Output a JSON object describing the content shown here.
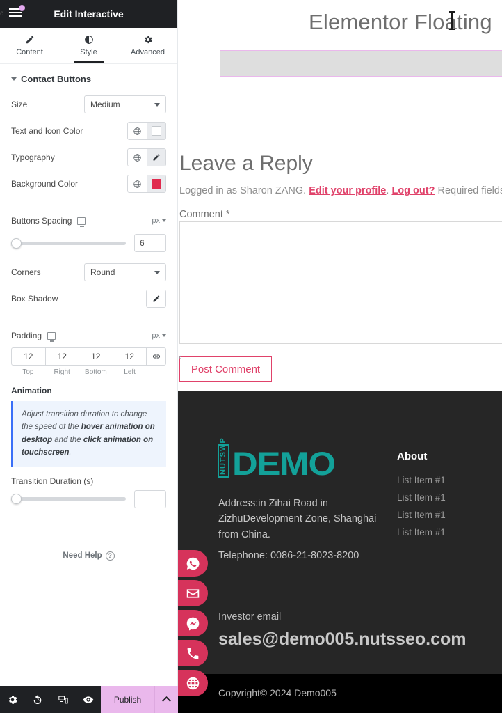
{
  "panel": {
    "title": "Edit Interactive",
    "edge_letter": "c",
    "menu_icon": "hamburger-icon",
    "tabs": [
      {
        "label": "Content",
        "icon": "pencil-icon",
        "active": false
      },
      {
        "label": "Style",
        "icon": "contrast-icon",
        "active": true
      },
      {
        "label": "Advanced",
        "icon": "gear-icon",
        "active": false
      }
    ],
    "section": {
      "title": "Contact Buttons"
    },
    "controls": {
      "size_label": "Size",
      "size_value": "Medium",
      "text_icon_color_label": "Text and Icon Color",
      "text_icon_color_value": "#FFFFFF",
      "typography_label": "Typography",
      "background_color_label": "Background Color",
      "background_color_value": "#E02B4E",
      "buttons_spacing_label": "Buttons Spacing",
      "buttons_spacing_unit": "px",
      "buttons_spacing_value": "6",
      "corners_label": "Corners",
      "corners_value": "Round",
      "box_shadow_label": "Box Shadow",
      "padding_label": "Padding",
      "padding_unit": "px",
      "padding_values": [
        "12",
        "12",
        "12",
        "12"
      ],
      "padding_labels": [
        "Top",
        "Right",
        "Bottom",
        "Left"
      ],
      "animation_label": "Animation",
      "notice_part1": "Adjust transition duration to change the speed of the ",
      "notice_bold1": "hover animation on desktop",
      "notice_part2": " and the ",
      "notice_bold2": "click animation on touchscreen",
      "notice_part3": ".",
      "transition_label": "Transition Duration (s)",
      "transition_value": ""
    },
    "need_help": "Need Help",
    "footer": {
      "tools": [
        "gear-icon",
        "history-icon",
        "responsive-icon",
        "preview-eye-icon"
      ],
      "publish_label": "Publish",
      "arrow_icon": "chevron-up-icon"
    },
    "collapse_icon": "chevron-left-icon"
  },
  "preview": {
    "site_title": "Elementor Floating",
    "selected_element": "",
    "comments": {
      "heading": "Leave a Reply",
      "logged_prefix": "Logged in as Sharon ZANG. ",
      "edit_profile_link": "Edit your profile",
      "mid_text": ". ",
      "logout_link": "Log out?",
      "required_text": " Required fields a",
      "comment_label": "Comment *",
      "comment_value": "",
      "post_button": "Post Comment"
    },
    "footer": {
      "logo_vertical": "NUTSWP",
      "logo_main": "DEMO",
      "address": "Address:in Zihai Road in ZizhuDevelopment Zone, Shanghai from China.",
      "telephone": "Telephone: 0086-21-8023-8200",
      "about_heading": "About",
      "about_items": [
        "List Item #1",
        "List Item #1",
        "List Item #1",
        "List Item #1"
      ],
      "investor_label": "Investor email",
      "investor_email": "sales@demo005.nutsseo.com",
      "copyright": "Copyright© 2024 Demo005"
    },
    "floating_buttons": [
      {
        "name": "whatsapp",
        "icon": "whatsapp-icon"
      },
      {
        "name": "email",
        "icon": "envelope-icon"
      },
      {
        "name": "messenger",
        "icon": "messenger-icon"
      },
      {
        "name": "phone",
        "icon": "phone-icon"
      },
      {
        "name": "website",
        "icon": "globe-icon"
      }
    ]
  },
  "colors": {
    "accent_pink": "#E0426A",
    "button_red": "#D6335B",
    "logo_teal": "#13A199",
    "publish_lilac": "#EAB8EC",
    "panel_dark": "#1F2124",
    "footer_dark": "#262626"
  }
}
